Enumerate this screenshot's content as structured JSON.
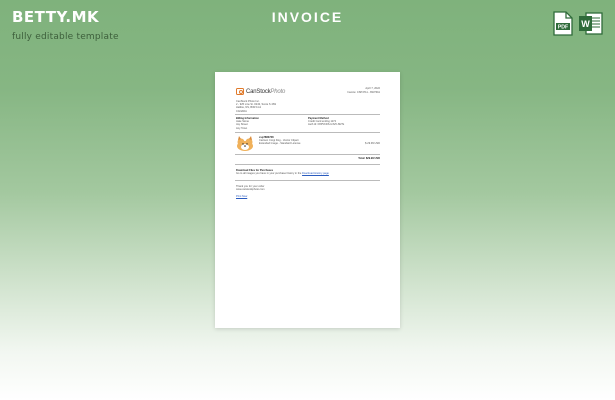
{
  "brand": {
    "logo": "BETTY.MK",
    "tagline": "fully editable template"
  },
  "page_title": "INVOICE",
  "formats": [
    {
      "icon": "pdf-file-icon",
      "label": "PDF",
      "color": "#2f6b3a"
    },
    {
      "icon": "word-file-icon",
      "label": "W",
      "color": "#2f6b3a"
    }
  ],
  "invoice": {
    "company": "CanStock",
    "company_suffix": "Photo",
    "date": "April 7, 2022",
    "invoice_no": "Invoice: CSP4711 - 8337911",
    "address": [
      "CanStock Photo Inc.",
      "2 - 925 Line St. #243, Scote S 4S9",
      "Halifax, NS, B3R 1G1",
      "CANADA"
    ],
    "billing_heading": "Billing Information",
    "billing_lines": [
      "Jake Stone",
      "Jay Street",
      "Any Town"
    ],
    "payment_heading": "Payment Method",
    "payment_lines": [
      "Credit Card ending 1172",
      "Auth Id: F8PVKDS-U4V6-Sf2Ts"
    ],
    "item_title": "csp7883738",
    "item_desc": [
      "Cartoon Corgi Dog - Vector Clipart",
      "Extended Image - Standard License"
    ],
    "item_price": "$ 29.99 USD",
    "total": "Total: $29.99 USD",
    "download_heading": "Download Files for Purchases",
    "download_note": "Go to all images you have in your purchase history in the",
    "download_link": "Download History page",
    "thanks": "Thank you for your order",
    "thanks_url": "www.canstockphoto.com",
    "print_link": "Print Now"
  }
}
